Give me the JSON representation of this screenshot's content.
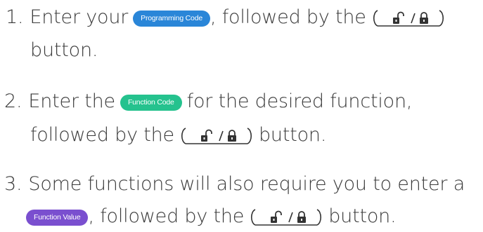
{
  "steps": [
    {
      "number": "1.",
      "text_a": "Enter your",
      "pill": "Programming Code",
      "text_b": ", followed by the",
      "line2": "button."
    },
    {
      "number": "2.",
      "text_a": "Enter the",
      "pill": "Function Code",
      "text_b": "for the desired function,",
      "line2_a": "followed by the",
      "line2_b": "button."
    },
    {
      "number": "3.",
      "text_a": "Some functions will also require you to enter a",
      "pill": "Function Value",
      "text_b": ", followed by the",
      "text_c": "button."
    }
  ],
  "lock_button_separator": "/",
  "lock_button_icons": [
    "unlock-icon",
    "lock-icon"
  ],
  "colors": {
    "text": "#3a3a3a",
    "programming_code_pill": "#2a86d8",
    "function_code_pill": "#25c28e",
    "function_value_pill": "#7a4fcf"
  }
}
